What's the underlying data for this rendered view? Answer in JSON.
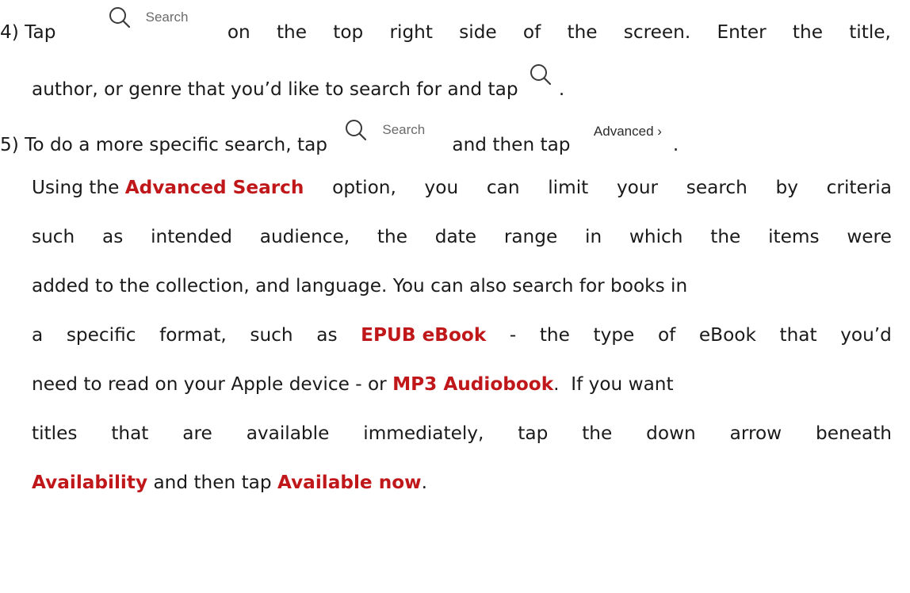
{
  "step4": {
    "prefix": "4) Tap",
    "search_chip_label": "Search",
    "after_chip_words": [
      "on",
      "the",
      "top",
      "right",
      "side",
      "of",
      "the",
      "screen.",
      "Enter",
      "the",
      "title,"
    ],
    "line2_text": "author,  or genre that you’d like to search for and tap",
    "line2_end": "."
  },
  "step5": {
    "prefix": "5) To do a more specific search, tap",
    "search_chip_label": "Search",
    "middle": "and then tap",
    "advanced_label": "Advanced ›",
    "line1_end": ".",
    "line2_before": "Using the",
    "line2_highlight": "Advanced Search",
    "line2_after_words": [
      "option,",
      "you",
      "can",
      "limit",
      "your",
      "search",
      "by",
      "criteria"
    ],
    "line3_words": [
      "such",
      "as",
      "intended",
      "audience,",
      "the",
      "date",
      "range",
      "in",
      "which",
      "the",
      "items",
      "were"
    ],
    "line4_text": "added to the collection, and language.  You can also search for books in",
    "line5_before_words": [
      "a",
      "specific",
      "format,",
      "such",
      "as"
    ],
    "line5_highlight": "EPUB eBook",
    "line5_after_words": [
      "-",
      "the",
      "type",
      "of",
      "eBook",
      "that",
      "you’d"
    ],
    "line6_before": "need to read on your Apple device - or",
    "line6_highlight": "MP3 Audiobook",
    "line6_after": ".  If you want",
    "line7_words": [
      "titles",
      "that",
      "are",
      "available",
      "immediately,",
      "tap",
      "the",
      "down",
      "arrow",
      "beneath"
    ],
    "line8_highlight1": "Availability",
    "line8_middle": " and then tap ",
    "line8_highlight2": "Available now",
    "line8_end": "."
  },
  "colors": {
    "highlight": "#c0171a",
    "text": "#1a1a1a",
    "chip_text": "#6b6b6b"
  },
  "icons": {
    "search": "magnifier-icon"
  }
}
